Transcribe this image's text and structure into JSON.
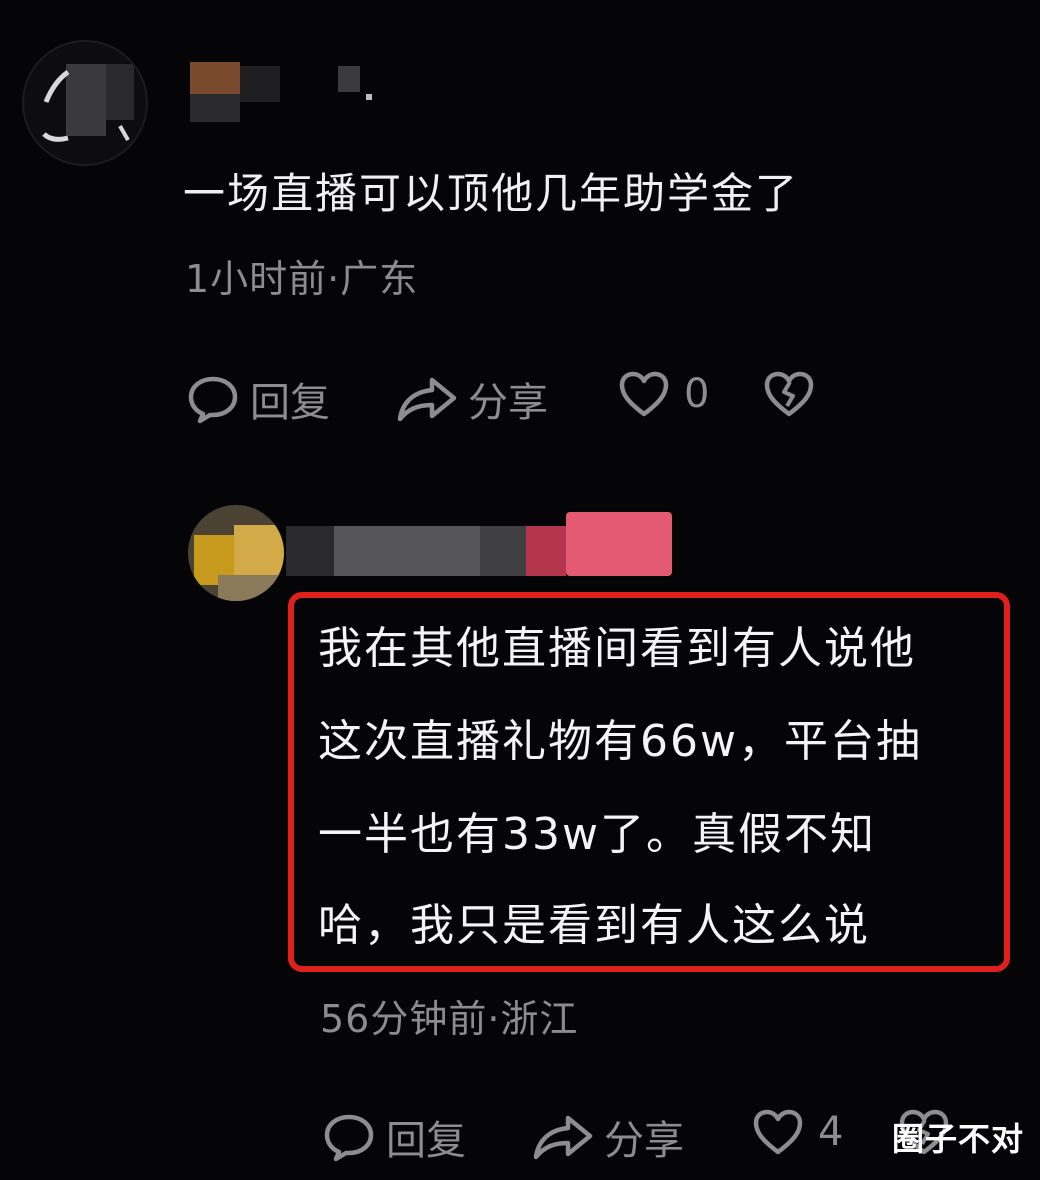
{
  "comment1": {
    "text": "一场直播可以顶他几年助学金了",
    "meta": "1小时前·广东",
    "actions": {
      "reply": "回复",
      "share": "分享",
      "likes": "0"
    }
  },
  "comment2": {
    "lines": [
      "我在其他直播间看到有人说他",
      "这次直播礼物有66w，平台抽",
      "一半也有33w了。真假不知",
      "哈，我只是看到有人这么说"
    ],
    "meta": "56分钟前·浙江",
    "actions": {
      "reply": "回复",
      "share": "分享",
      "likes": "4"
    }
  },
  "watermark": "圈子不对",
  "colors": {
    "background": "#050507",
    "highlight": "#e0201c",
    "meta_text": "#8b8b90"
  }
}
